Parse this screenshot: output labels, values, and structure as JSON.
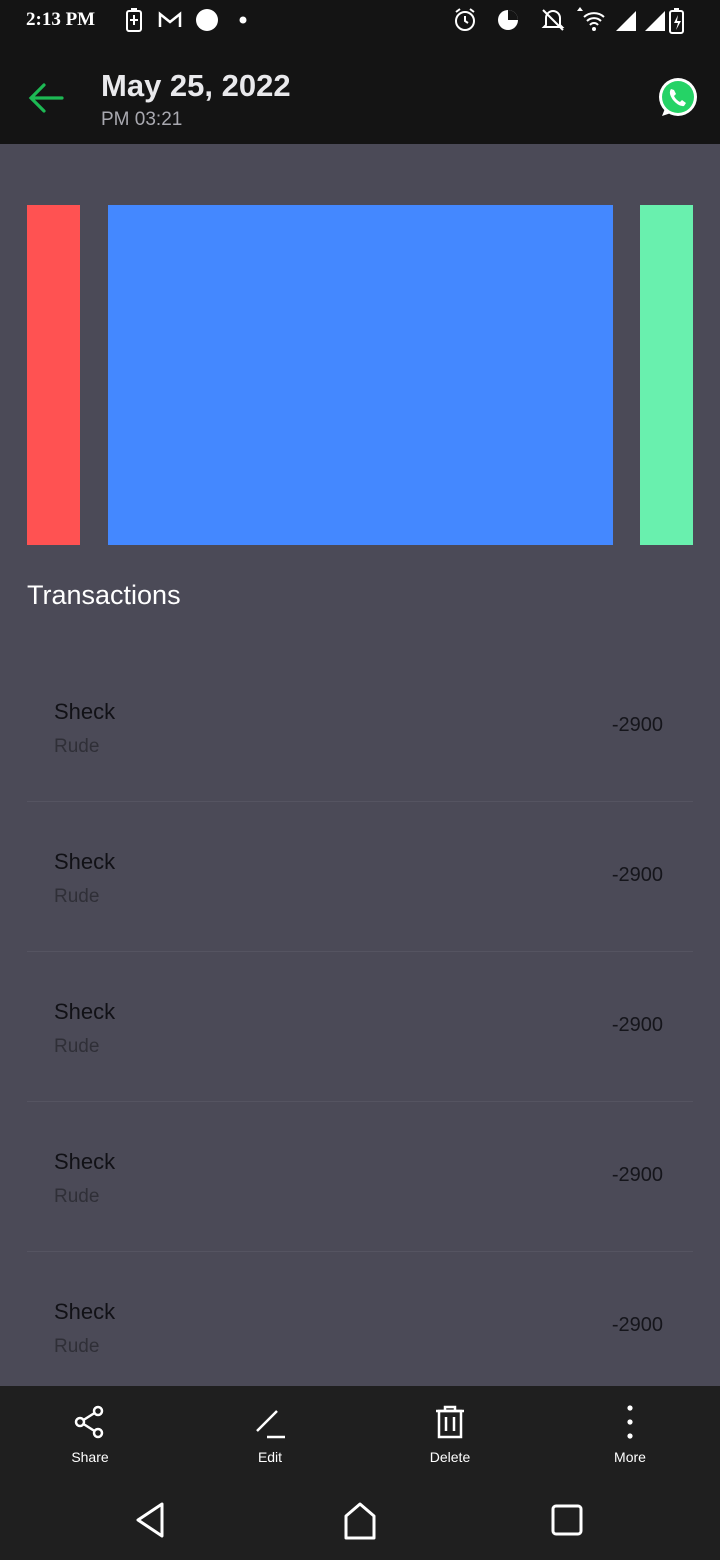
{
  "status_bar": {
    "time": "2:13 PM",
    "icons": [
      "battery-saver-icon",
      "gmail-icon",
      "circle-notification-icon",
      "dot-icon",
      "alarm-icon",
      "data-saver-icon",
      "notifications-off-icon",
      "wifi-icon",
      "signal-icon",
      "signal-icon",
      "battery-charging-icon"
    ]
  },
  "header": {
    "title": "May 25, 2022",
    "subtitle": "PM 03:21",
    "back_icon": "arrow-left-icon",
    "share_app_icon": "whatsapp-icon"
  },
  "colors": {
    "accent_green": "#1db954",
    "bar_red": "#ff5252",
    "bar_blue": "#4488ff",
    "bar_green": "#69f0ae",
    "background": "#4b4a57"
  },
  "section": {
    "title": "Transactions"
  },
  "transactions": [
    {
      "name": "Sheck",
      "category": "Rude",
      "amount": "-2900"
    },
    {
      "name": "Sheck",
      "category": "Rude",
      "amount": "-2900"
    },
    {
      "name": "Sheck",
      "category": "Rude",
      "amount": "-2900"
    },
    {
      "name": "Sheck",
      "category": "Rude",
      "amount": "-2900"
    },
    {
      "name": "Sheck",
      "category": "Rude",
      "amount": "-2900"
    }
  ],
  "actions": [
    {
      "label": "Share",
      "icon": "share-icon"
    },
    {
      "label": "Edit",
      "icon": "edit-icon"
    },
    {
      "label": "Delete",
      "icon": "trash-icon"
    },
    {
      "label": "More",
      "icon": "more-vert-icon"
    }
  ],
  "nav": [
    "back-triangle-icon",
    "home-icon",
    "recents-square-icon"
  ]
}
